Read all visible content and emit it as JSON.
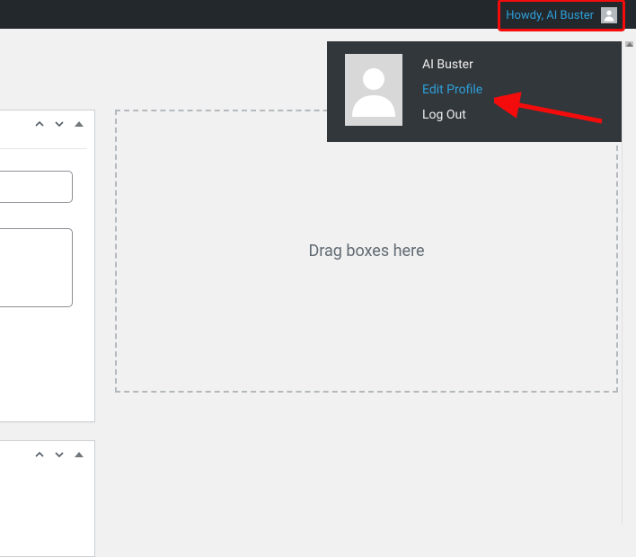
{
  "topbar": {
    "howdy_text": "Howdy, AI Buster"
  },
  "user_menu": {
    "display_name": "AI Buster",
    "edit_profile_label": "Edit Profile",
    "logout_label": "Log Out"
  },
  "dropzone": {
    "placeholder": "Drag boxes here"
  }
}
